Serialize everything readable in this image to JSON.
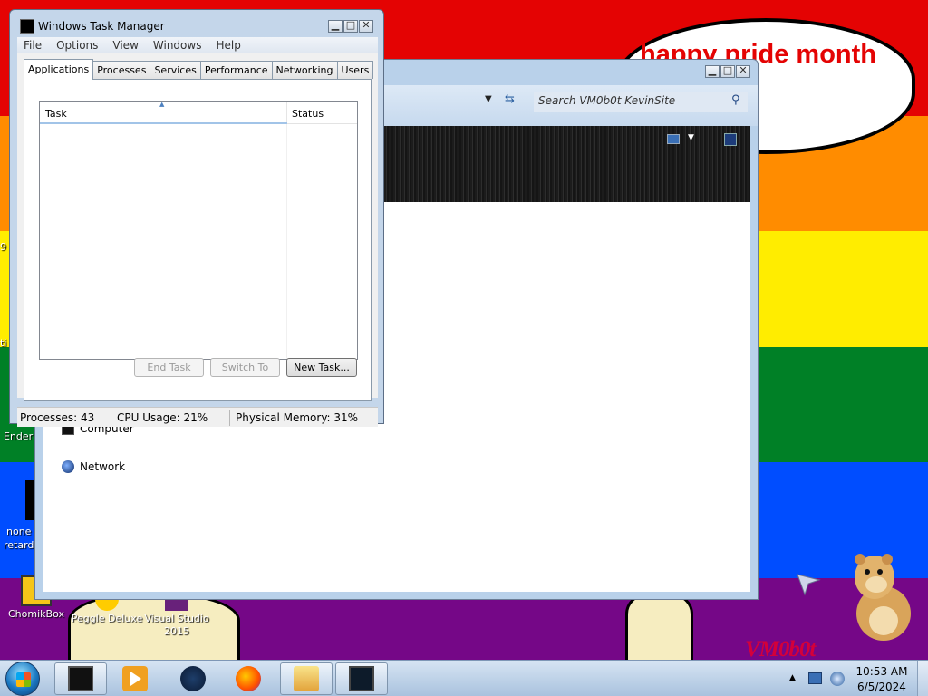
{
  "desktop": {
    "bubble_text": "happy pride month",
    "signature": "VM0b0t",
    "edge_labels": [
      "Ender",
      "none",
      "retard:"
    ],
    "icons": [
      {
        "label": "ChomikBox",
        "icon": "chomikbox-icon"
      },
      {
        "label": "Peggle Deluxe",
        "icon": "peggle-icon"
      },
      {
        "label": "Visual Studio 2015",
        "icon": "visual-studio-icon"
      }
    ],
    "colors": {
      "red": "#e40303",
      "orange": "#ff8c00",
      "yellow": "#ffed00",
      "green": "#008026",
      "blue": "#004dff",
      "violet": "#750787"
    }
  },
  "explorer": {
    "search_placeholder": "Search VM0b0t KevinSite",
    "nav": [
      {
        "label": "Computer",
        "icon": "computer-icon"
      },
      {
        "label": "Network",
        "icon": "network-icon"
      }
    ]
  },
  "task_manager": {
    "title": "Windows Task Manager",
    "menu": [
      "File",
      "Options",
      "View",
      "Windows",
      "Help"
    ],
    "tabs": [
      "Applications",
      "Processes",
      "Services",
      "Performance",
      "Networking",
      "Users"
    ],
    "active_tab": "Applications",
    "columns": {
      "task": "Task",
      "status": "Status"
    },
    "tasks": [],
    "buttons": {
      "end_task": "End Task",
      "switch_to": "Switch To",
      "new_task": "New Task..."
    },
    "status": {
      "processes": "Processes: 43",
      "cpu": "CPU Usage: 21%",
      "memory": "Physical Memory: 31%"
    }
  },
  "taskbar": {
    "apps": [
      "task-manager-icon",
      "media-player-icon",
      "steam-icon",
      "firefox-icon",
      "explorer-icon",
      "cmd-icon"
    ],
    "clock": {
      "time": "10:53 AM",
      "date": "6/5/2024"
    }
  }
}
